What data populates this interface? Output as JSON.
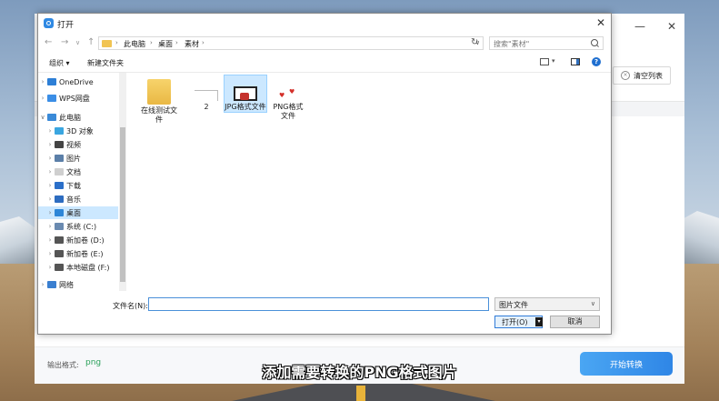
{
  "background_app": {
    "clear_list_label": "清空列表",
    "output_format_label": "输出格式:",
    "output_format_value": "png",
    "start_button_label": "开始转换",
    "window_close_glyph": "✕",
    "window_min_glyph": "—"
  },
  "dialog": {
    "title": "打开",
    "close_glyph": "✕",
    "breadcrumb": [
      "此电脑",
      "桌面",
      "素材"
    ],
    "search_placeholder": "搜索\"素材\"",
    "toolbar": {
      "organize": "组织 ▾",
      "new_folder": "新建文件夹"
    },
    "nav_items": [
      {
        "label": "OneDrive",
        "icon": "cloud-icon",
        "color": "#2d7fd6"
      },
      {
        "label": "WPS网盘",
        "icon": "wps-cloud-icon",
        "color": "#3b8ee6"
      },
      {
        "label": "此电脑",
        "icon": "computer-icon",
        "color": "#3a8ad8"
      },
      {
        "label": "3D 对象",
        "icon": "3d-objects-icon",
        "color": "#3aa6e0"
      },
      {
        "label": "视频",
        "icon": "video-icon",
        "color": "#444444"
      },
      {
        "label": "图片",
        "icon": "pictures-icon",
        "color": "#5b7fa8"
      },
      {
        "label": "文档",
        "icon": "documents-icon",
        "color": "#cfcfcf"
      },
      {
        "label": "下载",
        "icon": "downloads-icon",
        "color": "#2b6fc9"
      },
      {
        "label": "音乐",
        "icon": "music-icon",
        "color": "#2d6cc0"
      },
      {
        "label": "桌面",
        "icon": "desktop-icon",
        "color": "#2d86d8"
      },
      {
        "label": "系统 (C:)",
        "icon": "drive-c-icon",
        "color": "#6a8ab0"
      },
      {
        "label": "新加卷 (D:)",
        "icon": "drive-icon",
        "color": "#555555"
      },
      {
        "label": "新加卷 (E:)",
        "icon": "drive-icon",
        "color": "#555555"
      },
      {
        "label": "本地磁盘 (F:)",
        "icon": "drive-icon",
        "color": "#555555"
      },
      {
        "label": "网络",
        "icon": "network-icon",
        "color": "#3a7fd0"
      }
    ],
    "files": [
      {
        "name": "在线测试文件",
        "icon": "folder-icon"
      },
      {
        "name": "2",
        "icon": "file-icon"
      },
      {
        "name": "JPG格式文件",
        "icon": "jpg-image-icon"
      },
      {
        "name": "PNG格式文件",
        "icon": "png-image-icon"
      }
    ],
    "filename_label": "文件名(N):",
    "filename_value": "",
    "filetype_value": "图片文件",
    "open_label": "打开(O)",
    "cancel_label": "取消"
  },
  "subtitle": "添加需要转换的PNG格式图片"
}
